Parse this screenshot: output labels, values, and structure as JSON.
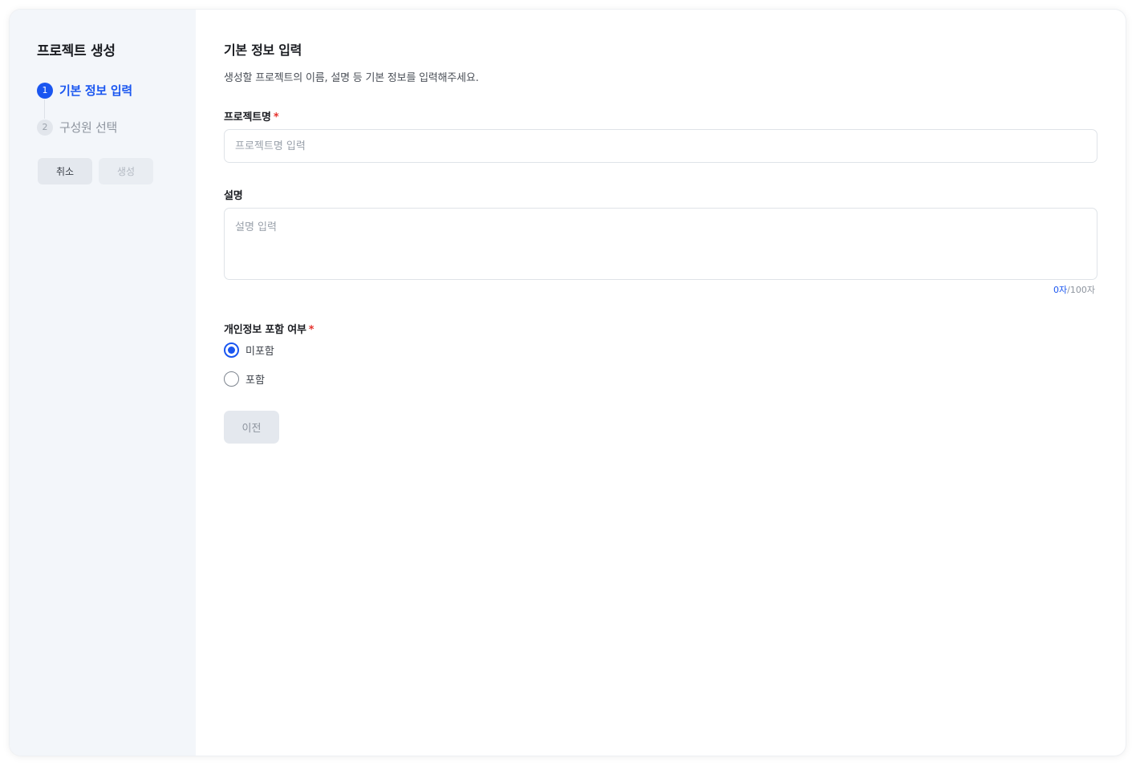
{
  "sidebar": {
    "title": "프로젝트 생성",
    "steps": [
      {
        "number": "1",
        "label": "기본 정보 입력",
        "active": true
      },
      {
        "number": "2",
        "label": "구성원 선택",
        "active": false
      }
    ],
    "cancel_label": "취소",
    "create_label": "생성"
  },
  "main": {
    "title": "기본 정보 입력",
    "description": "생성할 프로젝트의 이름, 설명 등 기본 정보를 입력해주세요.",
    "project_name": {
      "label": "프로젝트명",
      "required_mark": "*",
      "value": "",
      "placeholder": "프로젝트명 입력"
    },
    "description_field": {
      "label": "설명",
      "value": "",
      "placeholder": "설명 입력",
      "count": "0자",
      "max": "/100자"
    },
    "privacy": {
      "label": "개인정보 포함 여부",
      "required_mark": "*",
      "options": [
        {
          "label": "미포함",
          "selected": true
        },
        {
          "label": "포함",
          "selected": false
        }
      ]
    },
    "prev_label": "이전"
  },
  "colors": {
    "accent": "#1a56f0",
    "required": "#e5322d",
    "sidebar_bg": "#f3f6fa"
  }
}
